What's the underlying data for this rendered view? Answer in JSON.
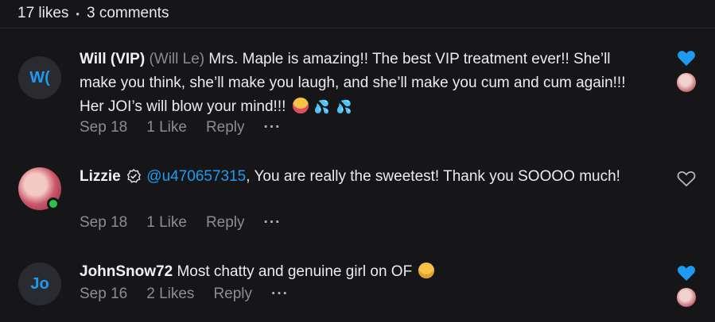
{
  "stats": {
    "likes": "17 likes",
    "separator": "•",
    "comments": "3 comments"
  },
  "comments": [
    {
      "avatar_initials": "W(",
      "name": "Will (VIP)",
      "handle": "(Will Le)",
      "text": "Mrs. Maple is amazing!! The best VIP treatment ever!! She’ll make you think, she’ll make you laugh, and she’ll make you cum and cum again!!! Her JOI’s will blow your mind!!!",
      "date": "Sep 18",
      "likes": "1 Like",
      "reply": "Reply",
      "more": "···",
      "liked": true
    },
    {
      "name": "Lizzie",
      "mention": "@u470657315",
      "text": ", You are really the sweetest! Thank you SOOOO much!",
      "date": "Sep 18",
      "likes": "1 Like",
      "reply": "Reply",
      "more": "···",
      "liked": false
    },
    {
      "avatar_initials": "Jo",
      "name": "JohnSnow72",
      "text": "Most chatty and genuine girl on OF",
      "date": "Sep 16",
      "likes": "2 Likes",
      "reply": "Reply",
      "more": "···",
      "liked": true
    }
  ],
  "colors": {
    "accent": "#1e9bf0",
    "online": "#2cc24b",
    "background": "#161618"
  }
}
